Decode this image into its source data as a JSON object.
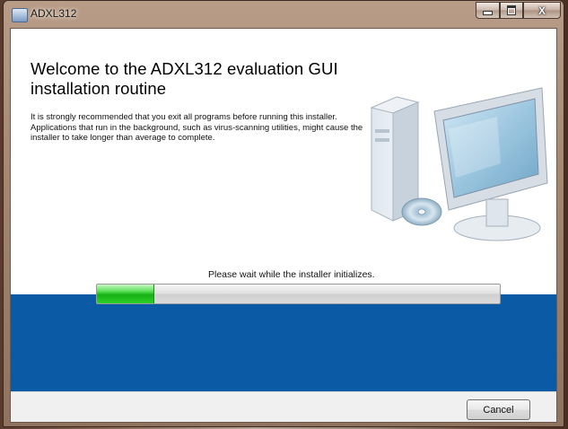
{
  "window": {
    "title": "ADXL312",
    "controls": {
      "minimize": "minimize-icon",
      "maximize": "maximize-icon",
      "close": "close-icon"
    }
  },
  "installer": {
    "heading": "Welcome to the ADXL312 evaluation GUI installation routine",
    "intro": "It is strongly recommended that you exit all programs before running this installer. Applications that run in the background, such as virus-scanning utilities, might cause the installer to take longer than average to complete.",
    "illustration": "computer-with-cd-icon",
    "status_text": "Please wait while the installer initializes.",
    "progress_fraction": 0.14,
    "colors": {
      "band": "#0b5aa6",
      "progress_green": "#16b014"
    }
  },
  "footer": {
    "cancel_label": "Cancel"
  }
}
